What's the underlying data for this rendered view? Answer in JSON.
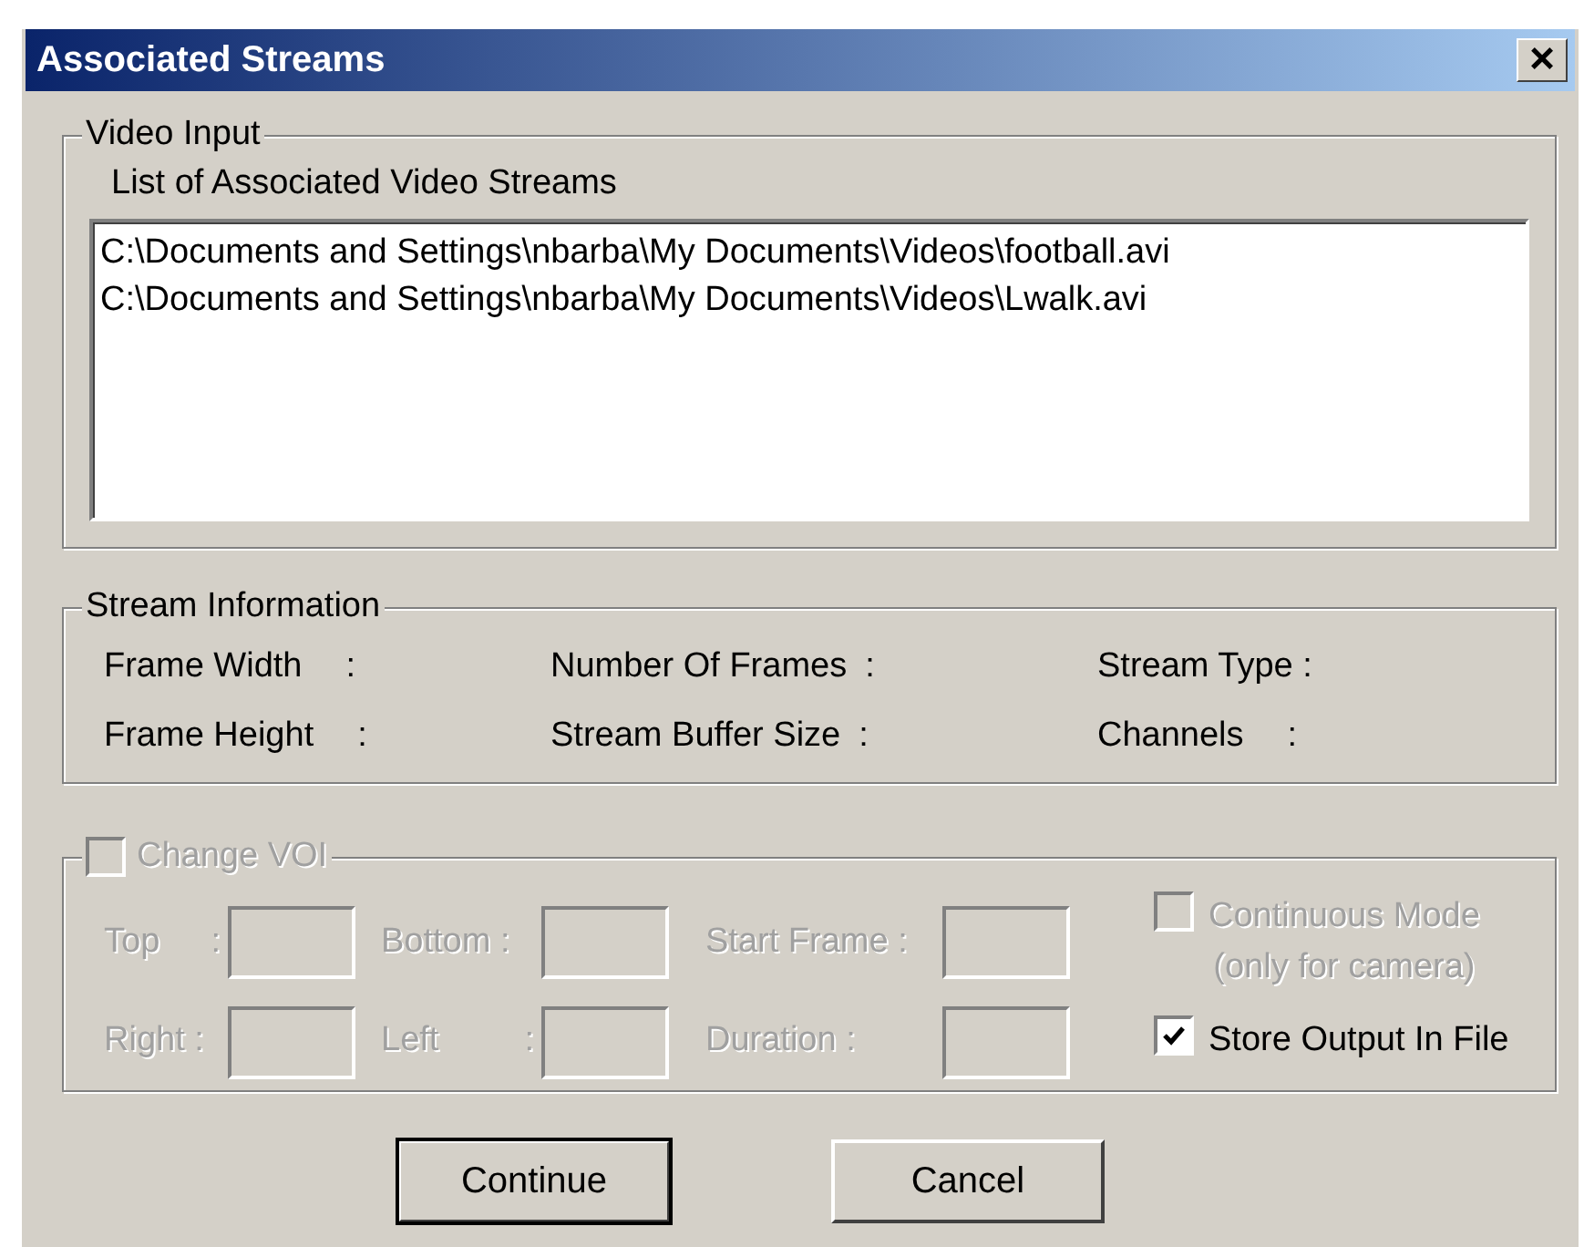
{
  "window": {
    "title": "Associated Streams",
    "close": "×"
  },
  "video_input": {
    "legend": "Video Input",
    "list_label": "List of Associated Video Streams",
    "streams": [
      {
        "text": "C:\\Documents and Settings\\nbarba\\My Documents\\Videos\\football.avi",
        "selected": false
      },
      {
        "text": "C:\\Documents and Settings\\nbarba\\My Documents\\Videos\\Lwalk.avi",
        "selected": false
      }
    ]
  },
  "stream_information": {
    "legend": "Stream Information",
    "fields": [
      {
        "label": "Frame Width",
        "colon": ":"
      },
      {
        "label": "Number Of Frames",
        "colon": ":"
      },
      {
        "label": "Stream Type :"
      },
      {
        "label": "Frame Height",
        "colon": ":"
      },
      {
        "label": "Stream Buffer Size",
        "colon": ":"
      },
      {
        "label": "Channels",
        "colon": ":"
      }
    ]
  },
  "voi": {
    "legend": "Change VOI",
    "checked": false,
    "disabled": true,
    "fields": [
      {
        "label": "Top",
        "colon": ":",
        "disabled": true
      },
      {
        "label": "Bottom :",
        "disabled": true
      },
      {
        "label": "Start Frame :",
        "disabled": true
      },
      {
        "label": "Right :",
        "disabled": true
      },
      {
        "label": "Left",
        "colon": ":",
        "disabled": true
      },
      {
        "label": "Duration :",
        "disabled": true
      }
    ],
    "options": [
      {
        "label": "Continuous Mode",
        "note": "(only for camera)",
        "checked": false,
        "disabled": true
      },
      {
        "label": "Store Output In File",
        "checked": true,
        "disabled": false
      }
    ]
  },
  "buttons": [
    {
      "label": "Continue",
      "default": true
    },
    {
      "label": "Cancel",
      "default": false
    }
  ]
}
